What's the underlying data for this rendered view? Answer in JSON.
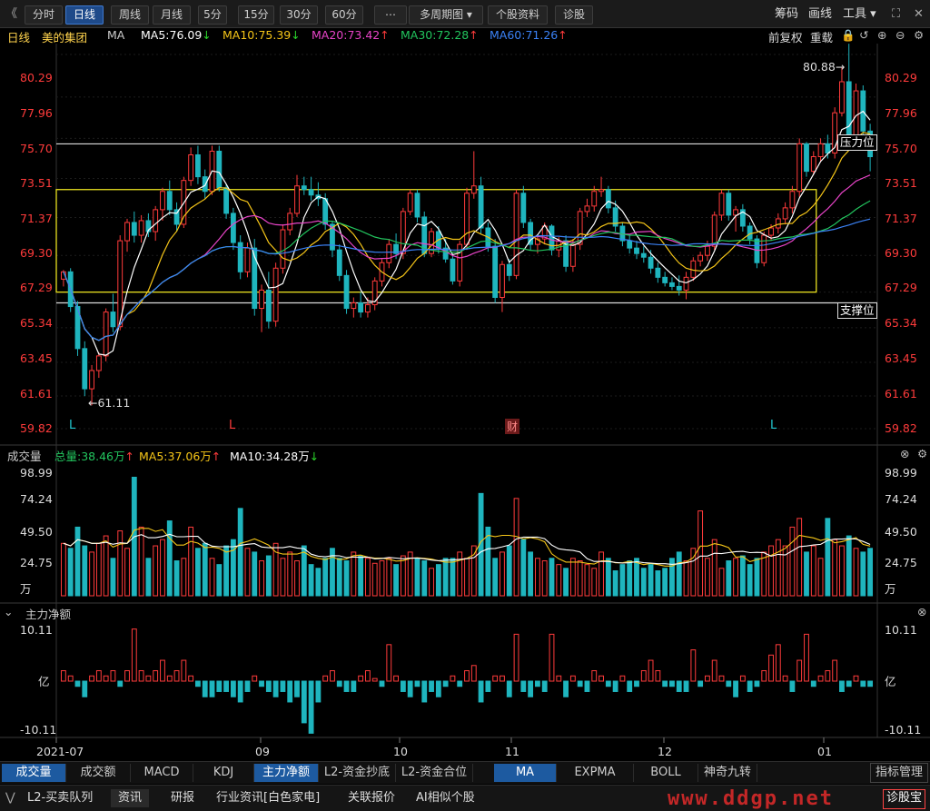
{
  "toolbar": {
    "back_glyph": "《",
    "buttons": [
      "分时",
      "日线",
      "周线",
      "月线",
      "5分",
      "15分",
      "30分",
      "60分",
      "⋯",
      "多周期图 ▾",
      "个股资料",
      "诊股"
    ],
    "active": "日线",
    "right_items": [
      "筹码",
      "画线",
      "工具 ▾",
      "⛶",
      "✕"
    ]
  },
  "info": {
    "period": "日线",
    "stock_name": "美的集团",
    "indicator": "MA",
    "ma5": "MA5:76.09",
    "ma10": "MA10:75.39",
    "ma20": "MA20:73.42",
    "ma30": "MA30:72.28",
    "ma60": "MA60:71.26",
    "adj_mode": "前复权",
    "reset": "重载",
    "colors": {
      "ma5": "#ffffff",
      "ma10": "#f5c518",
      "ma20": "#e844c8",
      "ma30": "#22c55e",
      "ma60": "#3b82f6",
      "up": "#ff3b3b",
      "down": "#1fb5be"
    }
  },
  "price_axis": {
    "ticks": [
      "80.29",
      "77.96",
      "75.70",
      "73.51",
      "71.37",
      "69.30",
      "67.29",
      "65.34",
      "63.45",
      "61.61",
      "59.82"
    ],
    "high_label": "80.88",
    "low_label": "61.11",
    "resistance_label": "压力位",
    "support_label": "支撑位",
    "markers": [
      {
        "text": "L",
        "color": "cyan"
      },
      {
        "text": "L",
        "color": "red"
      },
      {
        "text": "财",
        "color": "red"
      },
      {
        "text": "L",
        "color": "cyan"
      }
    ]
  },
  "volume": {
    "title": "成交量",
    "total": "总量:38.46万",
    "ma5": "MA5:37.06万",
    "ma10": "MA10:34.28万",
    "ticks": [
      "98.99",
      "74.24",
      "49.50",
      "24.75",
      "万"
    ]
  },
  "flow": {
    "title": "主力净额",
    "ticks": [
      "10.11",
      "亿",
      "-10.11"
    ]
  },
  "x_axis": [
    "2021-07",
    "09",
    "10",
    "11",
    "12",
    "01"
  ],
  "bottom_tabs": {
    "left": [
      "成交量",
      "成交额",
      "MACD",
      "KDJ",
      "主力净额",
      "L2-资金抄底",
      "L2-资金合位"
    ],
    "selected_left": [
      "成交量",
      "主力净额"
    ],
    "middle": [
      "MA",
      "EXPMA",
      "BOLL",
      "神奇九转"
    ],
    "selected_middle": "MA",
    "right": "指标管理"
  },
  "bottom_bar": {
    "items": [
      "L2-买卖队列",
      "资讯",
      "研报",
      "行业资讯[白色家电]",
      "关联报价",
      "AI相似个股"
    ],
    "selected": "资讯",
    "right_button": "诊股宝",
    "watermark": "www.ddgp.net"
  },
  "chart_data": {
    "type": "candlestick",
    "title": "",
    "ylim": [
      59.82,
      80.29
    ],
    "candles": [
      [
        68.0,
        68.5,
        67.6,
        68.4
      ],
      [
        68.4,
        68.6,
        66.2,
        66.5
      ],
      [
        66.5,
        66.8,
        63.8,
        64.2
      ],
      [
        64.2,
        64.6,
        61.6,
        62.0
      ],
      [
        62.0,
        63.3,
        61.1,
        63.0
      ],
      [
        63.0,
        64.0,
        62.6,
        63.8
      ],
      [
        63.8,
        66.4,
        63.5,
        66.2
      ],
      [
        66.2,
        67.2,
        65.1,
        65.4
      ],
      [
        65.4,
        70.4,
        65.2,
        70.1
      ],
      [
        70.1,
        71.3,
        69.5,
        71.1
      ],
      [
        71.1,
        71.7,
        70.0,
        70.4
      ],
      [
        70.4,
        71.5,
        70.0,
        71.2
      ],
      [
        71.2,
        71.6,
        70.3,
        70.6
      ],
      [
        70.6,
        72.0,
        70.1,
        71.8
      ],
      [
        71.8,
        73.0,
        71.2,
        72.8
      ],
      [
        72.8,
        73.4,
        71.5,
        71.8
      ],
      [
        71.8,
        72.2,
        70.6,
        71.0
      ],
      [
        71.0,
        73.6,
        70.8,
        73.4
      ],
      [
        73.4,
        75.2,
        73.1,
        74.8
      ],
      [
        74.8,
        75.3,
        73.2,
        73.6
      ],
      [
        73.6,
        74.0,
        72.4,
        72.8
      ],
      [
        72.8,
        75.3,
        72.6,
        75.0
      ],
      [
        75.0,
        75.3,
        72.8,
        73.0
      ],
      [
        73.0,
        73.2,
        71.3,
        71.6
      ],
      [
        71.6,
        71.9,
        69.6,
        70.0
      ],
      [
        70.0,
        70.4,
        68.0,
        68.4
      ],
      [
        68.4,
        70.0,
        68.1,
        69.7
      ],
      [
        69.7,
        70.2,
        66.0,
        66.4
      ],
      [
        66.4,
        67.7,
        65.1,
        67.4
      ],
      [
        67.4,
        68.4,
        65.3,
        65.7
      ],
      [
        65.7,
        68.9,
        65.4,
        68.6
      ],
      [
        68.6,
        71.0,
        68.3,
        70.7
      ],
      [
        70.7,
        71.9,
        70.4,
        71.6
      ],
      [
        71.6,
        73.7,
        71.4,
        73.1
      ],
      [
        73.1,
        73.6,
        72.6,
        72.9
      ],
      [
        72.9,
        73.6,
        72.3,
        72.6
      ],
      [
        72.6,
        73.3,
        72.0,
        72.4
      ],
      [
        72.4,
        72.7,
        70.7,
        71.0
      ],
      [
        71.0,
        71.2,
        69.2,
        69.6
      ],
      [
        69.6,
        69.9,
        67.9,
        68.2
      ],
      [
        68.2,
        68.5,
        66.1,
        66.4
      ],
      [
        66.4,
        67.0,
        65.9,
        66.7
      ],
      [
        66.7,
        67.3,
        65.9,
        66.2
      ],
      [
        66.2,
        67.0,
        65.9,
        66.6
      ],
      [
        66.6,
        68.1,
        66.3,
        67.9
      ],
      [
        67.9,
        69.1,
        67.6,
        68.9
      ],
      [
        68.9,
        70.2,
        68.6,
        69.9
      ],
      [
        69.9,
        70.5,
        69.1,
        69.4
      ],
      [
        69.4,
        71.9,
        69.1,
        71.7
      ],
      [
        71.7,
        72.9,
        71.5,
        72.7
      ],
      [
        72.7,
        72.9,
        71.1,
        71.4
      ],
      [
        71.4,
        71.7,
        69.2,
        69.4
      ],
      [
        69.4,
        70.8,
        69.2,
        70.6
      ],
      [
        70.6,
        70.9,
        69.4,
        69.7
      ],
      [
        69.7,
        70.2,
        68.9,
        69.1
      ],
      [
        69.1,
        69.4,
        67.7,
        67.9
      ],
      [
        67.9,
        70.1,
        67.6,
        69.9
      ],
      [
        69.9,
        73.0,
        69.6,
        72.7
      ],
      [
        72.7,
        75.0,
        72.4,
        73.1
      ],
      [
        73.1,
        73.6,
        70.5,
        70.8
      ],
      [
        70.8,
        71.1,
        69.5,
        69.8
      ],
      [
        69.8,
        70.2,
        66.7,
        67.0
      ],
      [
        67.0,
        69.0,
        66.2,
        68.8
      ],
      [
        68.8,
        69.1,
        67.9,
        68.2
      ],
      [
        68.2,
        72.9,
        68.0,
        72.7
      ],
      [
        72.7,
        73.1,
        70.8,
        71.1
      ],
      [
        71.1,
        71.3,
        69.6,
        69.9
      ],
      [
        69.9,
        70.4,
        69.4,
        70.2
      ],
      [
        70.2,
        71.1,
        69.9,
        70.9
      ],
      [
        70.9,
        71.0,
        69.3,
        69.6
      ],
      [
        69.6,
        70.3,
        69.2,
        70.1
      ],
      [
        70.1,
        70.4,
        68.4,
        68.7
      ],
      [
        68.7,
        70.2,
        68.4,
        69.9
      ],
      [
        69.9,
        71.9,
        69.6,
        71.7
      ],
      [
        71.7,
        72.4,
        71.4,
        72.0
      ],
      [
        72.0,
        73.1,
        71.7,
        72.8
      ],
      [
        72.8,
        73.6,
        72.5,
        72.9
      ],
      [
        72.9,
        73.1,
        71.6,
        71.9
      ],
      [
        71.9,
        72.3,
        70.6,
        70.9
      ],
      [
        70.9,
        71.1,
        69.8,
        70.1
      ],
      [
        70.1,
        70.4,
        69.4,
        69.7
      ],
      [
        69.7,
        70.1,
        69.1,
        69.4
      ],
      [
        69.4,
        69.8,
        68.9,
        69.2
      ],
      [
        69.2,
        69.6,
        68.3,
        68.6
      ],
      [
        68.6,
        68.9,
        67.8,
        68.1
      ],
      [
        68.1,
        68.4,
        67.6,
        67.8
      ],
      [
        67.8,
        68.1,
        67.4,
        67.6
      ],
      [
        67.6,
        68.2,
        67.1,
        67.4
      ],
      [
        67.4,
        68.4,
        66.9,
        68.1
      ],
      [
        68.1,
        69.2,
        67.9,
        69.0
      ],
      [
        69.0,
        69.5,
        68.7,
        69.3
      ],
      [
        69.3,
        70.1,
        69.0,
        69.8
      ],
      [
        69.8,
        71.7,
        69.6,
        71.5
      ],
      [
        71.5,
        72.9,
        71.2,
        72.7
      ],
      [
        72.7,
        72.9,
        71.2,
        71.5
      ],
      [
        71.5,
        72.0,
        70.6,
        71.8
      ],
      [
        71.8,
        72.1,
        70.6,
        70.9
      ],
      [
        70.9,
        71.1,
        69.9,
        70.2
      ],
      [
        70.2,
        70.4,
        68.6,
        68.9
      ],
      [
        68.9,
        70.6,
        68.7,
        70.4
      ],
      [
        70.4,
        71.0,
        70.1,
        70.8
      ],
      [
        70.8,
        71.6,
        70.5,
        71.3
      ],
      [
        71.3,
        72.2,
        71.0,
        71.9
      ],
      [
        71.9,
        73.1,
        71.6,
        72.8
      ],
      [
        72.8,
        75.7,
        72.5,
        75.4
      ],
      [
        75.4,
        75.5,
        73.6,
        73.9
      ],
      [
        73.9,
        75.0,
        73.7,
        74.7
      ],
      [
        74.7,
        75.7,
        74.4,
        75.4
      ],
      [
        75.4,
        75.9,
        74.6,
        74.9
      ],
      [
        74.9,
        77.4,
        74.6,
        77.1
      ],
      [
        77.1,
        79.6,
        76.9,
        78.8
      ],
      [
        78.8,
        80.88,
        75.2,
        75.6
      ],
      [
        75.6,
        78.7,
        75.4,
        78.3
      ],
      [
        78.3,
        78.6,
        75.7,
        76.1
      ],
      [
        76.1,
        76.5,
        73.9,
        74.7
      ]
    ],
    "volume": [
      42,
      38,
      55,
      40,
      35,
      42,
      48,
      30,
      52,
      38,
      95,
      55,
      30,
      40,
      45,
      60,
      28,
      30,
      55,
      38,
      42,
      30,
      25,
      40,
      45,
      70,
      38,
      35,
      28,
      32,
      42,
      30,
      35,
      28,
      40,
      25,
      22,
      30,
      38,
      30,
      28,
      35,
      32,
      30,
      26,
      28,
      30,
      25,
      32,
      35,
      30,
      28,
      22,
      25,
      30,
      30,
      35,
      30,
      40,
      82,
      55,
      30,
      35,
      40,
      78,
      45,
      35,
      30,
      28,
      30,
      25,
      22,
      30,
      28,
      25,
      22,
      35,
      30,
      20,
      25,
      28,
      30,
      22,
      25,
      20,
      22,
      30,
      35,
      28,
      38,
      68,
      30,
      45,
      22,
      28,
      30,
      32,
      25,
      30,
      35,
      40,
      45,
      40,
      55,
      62,
      35,
      40,
      30,
      62,
      45,
      40,
      48,
      38,
      35,
      38
    ],
    "net_flow": [
      2,
      1,
      -1,
      -3,
      1,
      2,
      1,
      2,
      -1,
      2,
      10,
      2,
      1,
      2,
      4,
      1,
      2,
      4,
      1,
      -1,
      -3,
      -3,
      -2,
      -2,
      -3,
      -4,
      -2,
      1,
      -1,
      -2,
      -3,
      -2,
      -4,
      -3,
      -8,
      -10,
      -4,
      1,
      2,
      -1,
      -2,
      -2,
      1,
      2,
      0.5,
      -1,
      7,
      1,
      -2,
      -3,
      -1,
      -4,
      -2,
      -3,
      -1,
      1,
      -1,
      2,
      3,
      -4,
      -2,
      1,
      1,
      -3,
      9,
      -2,
      -3,
      -1,
      -2,
      9,
      1,
      -3,
      1,
      -1,
      -2,
      2,
      1,
      -1,
      -2,
      1,
      -2,
      -1,
      2,
      4,
      2,
      -1,
      -1,
      -2,
      -2,
      6,
      -1,
      1,
      4,
      1,
      -1,
      -3,
      1,
      -2,
      -1,
      2,
      5,
      7,
      1,
      -2,
      4,
      9,
      -1,
      1,
      2,
      4,
      -2,
      -1,
      1,
      -1,
      -1
    ],
    "ma_lines": [
      {
        "name": "MA5",
        "color": "#ffffff"
      },
      {
        "name": "MA10",
        "color": "#f5c518"
      },
      {
        "name": "MA20",
        "color": "#e844c8"
      },
      {
        "name": "MA30",
        "color": "#22c55e"
      },
      {
        "name": "MA60",
        "color": "#3b82f6"
      }
    ],
    "resistance": 72.9,
    "support": 67.29,
    "upper_line": 75.4,
    "lower_line": 66.7
  }
}
